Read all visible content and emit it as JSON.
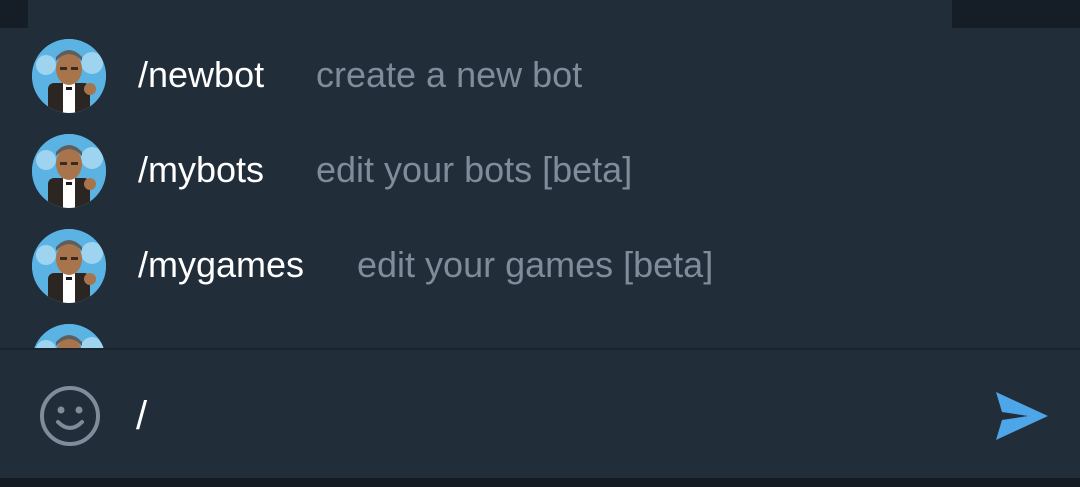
{
  "commands": [
    {
      "name": "/newbot",
      "description": "create a new bot"
    },
    {
      "name": "/mybots",
      "description": "edit your bots [beta]"
    },
    {
      "name": "/mygames",
      "description": "edit your games [beta]"
    },
    {
      "name": "",
      "description": ""
    }
  ],
  "input": {
    "value": "/",
    "emoji_icon": "smile-icon",
    "send_icon": "send-icon"
  },
  "colors": {
    "panel": "#222d3a",
    "background": "#141b23",
    "command_text": "#ffffff",
    "description_text": "#7f8c9a",
    "accent": "#4da6e8"
  }
}
